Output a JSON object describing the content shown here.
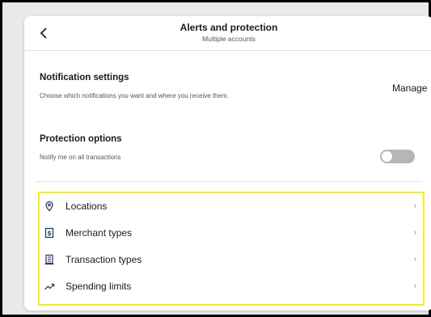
{
  "header": {
    "title": "Alerts and protection",
    "subtitle": "Multiple accounts",
    "back_icon": "chevron-left-icon"
  },
  "notification_settings": {
    "title": "Notification settings",
    "description": "Choose which notifications you want and where you receive them.",
    "action_label": "Manage"
  },
  "protection_options": {
    "title": "Protection options",
    "description": "Notify me on all transactions",
    "toggle_on": false
  },
  "controls": {
    "highlight_color": "#f2ee1f",
    "items": [
      {
        "label": "Locations",
        "icon": "location-pin-icon"
      },
      {
        "label": "Merchant types",
        "icon": "merchant-icon"
      },
      {
        "label": "Transaction types",
        "icon": "building-icon"
      },
      {
        "label": "Spending limits",
        "icon": "trending-up-icon"
      }
    ]
  }
}
